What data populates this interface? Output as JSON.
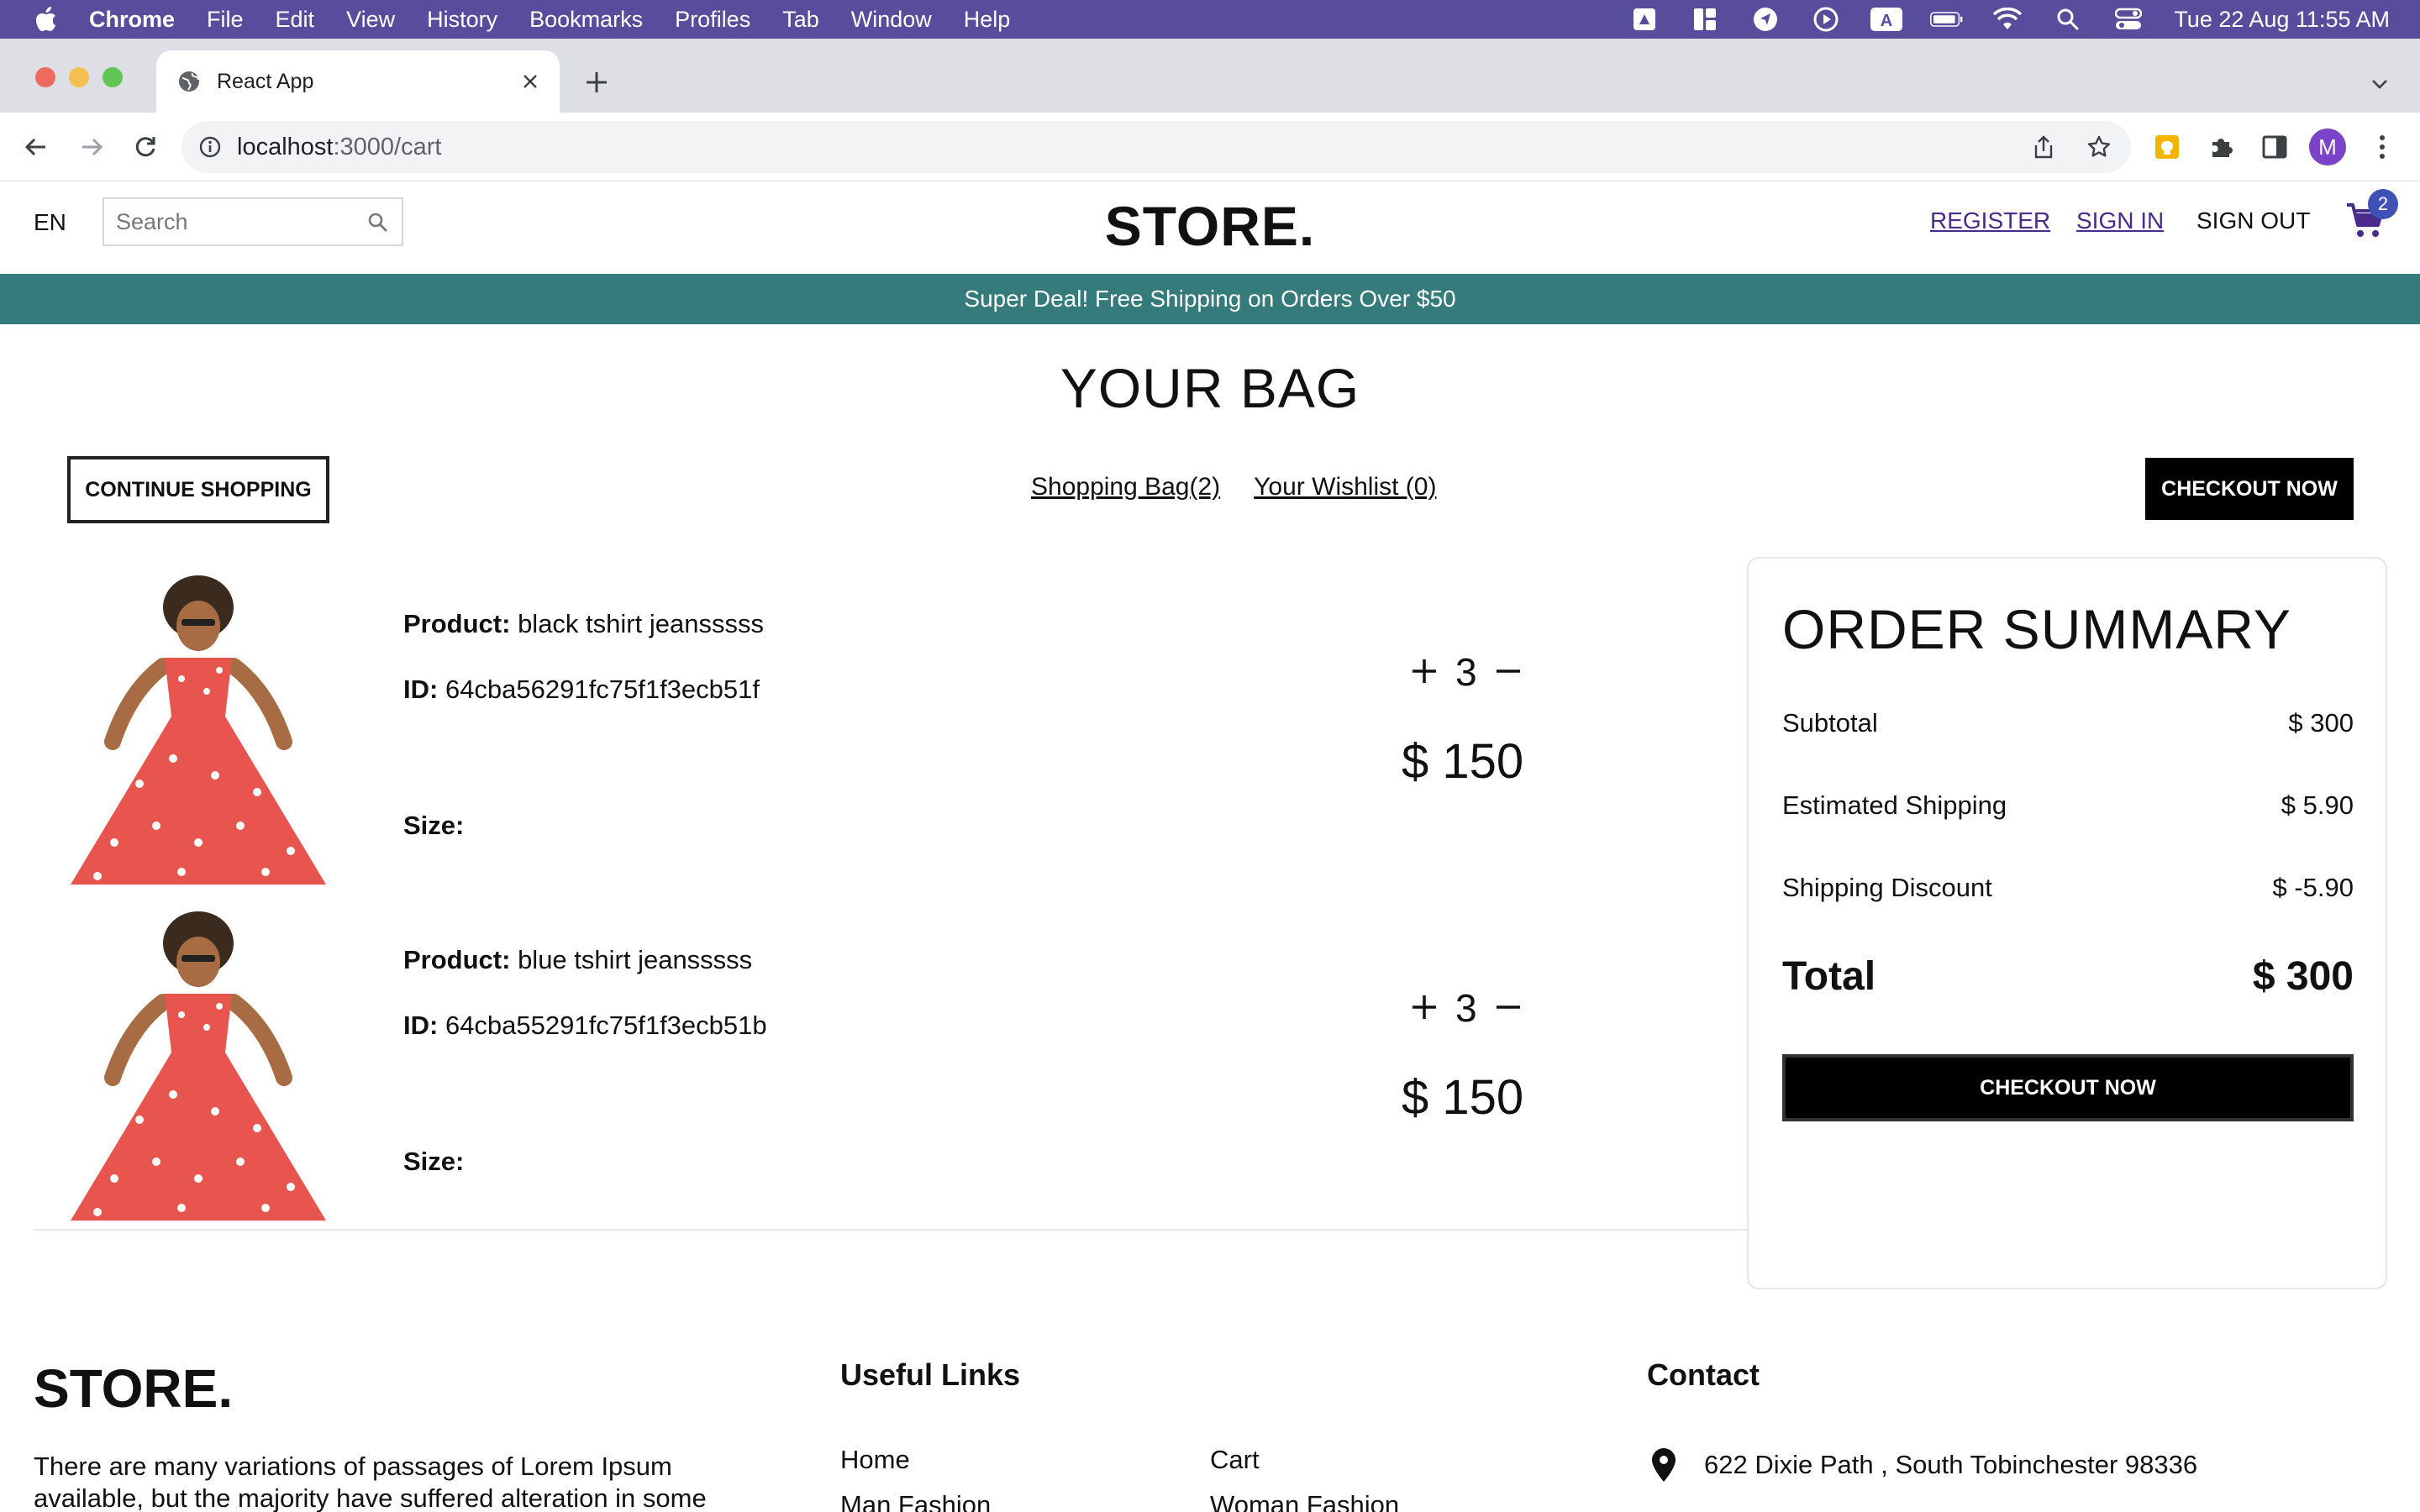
{
  "menubar": {
    "app_name": "Chrome",
    "items": [
      "File",
      "Edit",
      "View",
      "History",
      "Bookmarks",
      "Profiles",
      "Tab",
      "Window",
      "Help"
    ],
    "clock": "Tue 22 Aug  11:55 AM",
    "status_icons": [
      "drive-icon",
      "dashboard-icon",
      "navigation-icon",
      "play-icon",
      "keyboard-a-icon",
      "battery-icon",
      "wifi-icon",
      "spotlight-search-icon",
      "control-center-icon"
    ]
  },
  "browser": {
    "tab_title": "React App",
    "url_host": "localhost",
    "url_path": ":3000/cart",
    "profile_initial": "M"
  },
  "header": {
    "language": "EN",
    "search_placeholder": "Search",
    "logo": "STORE.",
    "register": "REGISTER",
    "sign_in": "SIGN IN",
    "sign_out": "SIGN OUT",
    "cart_count": "2"
  },
  "announcement": "Super Deal! Free Shipping on Orders Over $50",
  "cart": {
    "title": "YOUR BAG",
    "continue_label": "CONTINUE SHOPPING",
    "shopping_bag_link": "Shopping Bag(2)",
    "wishlist_link": "Your Wishlist (0)",
    "checkout_label": "CHECKOUT NOW",
    "product_label": "Product:",
    "id_label": "ID:",
    "size_label": "Size:",
    "products": [
      {
        "name": "black tshirt jeansssss",
        "id": "64cba56291fc75f1f3ecb51f",
        "size": "",
        "quantity": "3",
        "price": "$ 150"
      },
      {
        "name": "blue tshirt jeansssss",
        "id": "64cba55291fc75f1f3ecb51b",
        "size": "",
        "quantity": "3",
        "price": "$ 150"
      }
    ]
  },
  "summary": {
    "title": "ORDER SUMMARY",
    "rows": [
      {
        "label": "Subtotal",
        "value": "$ 300"
      },
      {
        "label": "Estimated Shipping",
        "value": "$ 5.90"
      },
      {
        "label": "Shipping Discount",
        "value": "$ -5.90"
      }
    ],
    "total_label": "Total",
    "total_value": "$ 300",
    "checkout_label": "CHECKOUT NOW"
  },
  "footer": {
    "logo": "STORE.",
    "description": "There are many variations of passages of Lorem Ipsum available, but the majority have suffered alteration in some",
    "useful_links_title": "Useful Links",
    "links_col1": [
      "Home",
      "Man Fashion"
    ],
    "links_col2": [
      "Cart",
      "Woman Fashion"
    ],
    "contact_title": "Contact",
    "address": "622 Dixie Path , South Tobinchester 98336"
  },
  "colors": {
    "menubar": "#574d9c",
    "announcement_bg": "#357b7b",
    "link_purple": "#4a2a8a",
    "badge": "#3f51b5",
    "dress": "#e8554f"
  }
}
